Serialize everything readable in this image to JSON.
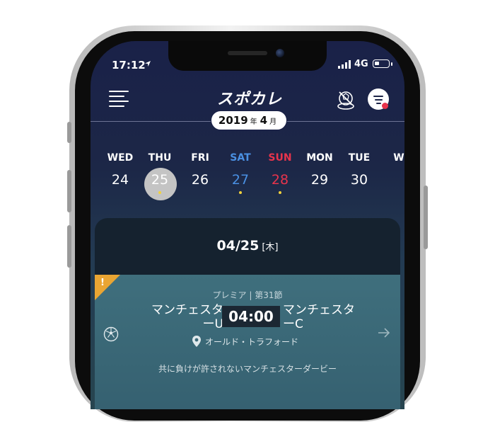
{
  "status_bar": {
    "time": "17:12",
    "network": "4G"
  },
  "header": {
    "app_title": "スポカレ"
  },
  "month_selector": {
    "year": "2019",
    "year_unit": "年",
    "month": "4",
    "month_unit": "月"
  },
  "week": [
    {
      "dow": "WED",
      "date": "24",
      "color": "#ffffff",
      "has_event": false
    },
    {
      "dow": "THU",
      "date": "25",
      "color": "#ffffff",
      "has_event": true,
      "selected": true
    },
    {
      "dow": "FRI",
      "date": "26",
      "color": "#ffffff",
      "has_event": false
    },
    {
      "dow": "SAT",
      "date": "27",
      "color": "#4a90e2",
      "has_event": true
    },
    {
      "dow": "SUN",
      "date": "28",
      "color": "#e7344c",
      "has_event": true
    },
    {
      "dow": "MON",
      "date": "29",
      "color": "#ffffff",
      "has_event": false
    },
    {
      "dow": "TUE",
      "date": "30",
      "color": "#ffffff",
      "has_event": false
    },
    {
      "dow": "W",
      "date": "",
      "color": "#ffffff",
      "has_event": false
    }
  ],
  "selected_date": {
    "date": "04/25",
    "weekday": "[木]"
  },
  "match": {
    "league": "プレミア | 第31節",
    "home_line1": "マンチェスタ",
    "home_line2": "ーU",
    "away_line1": "マンチェスタ",
    "away_line2": "ーC",
    "kickoff": "04:00",
    "venue": "オールド・トラフォード",
    "description": "共に負けが許されないマンチェスターダービー",
    "badge": "!"
  },
  "colors": {
    "sat": "#4a90e2",
    "sun": "#e7344c",
    "event_dot": "#f2d23c",
    "badge": "#e9a533"
  }
}
